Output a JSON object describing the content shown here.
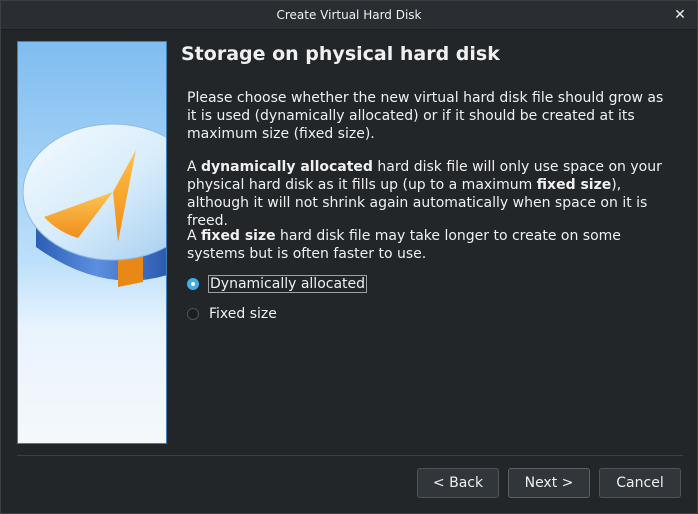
{
  "window": {
    "title": "Create Virtual Hard Disk"
  },
  "page": {
    "heading": "Storage on physical hard disk",
    "intro": "Please choose whether the new virtual hard disk file should grow as it is used (dynamically allocated) or if it should be created at its maximum size (fixed size).",
    "dynamic_desc": {
      "part1_bold": "dynamically allocated",
      "part0": "A ",
      "part2": " hard disk file will only use space on your physical hard disk as it fills up (up to a maximum ",
      "part3_bold": "fixed size",
      "part4": "), although it will not shrink again automatically when space on it is freed."
    },
    "fixed_desc": {
      "part0": "A ",
      "part1_bold": "fixed size",
      "part2": " hard disk file may take longer to create on some systems but is often faster to use."
    },
    "options": [
      {
        "label": "Dynamically allocated",
        "selected": true
      },
      {
        "label": "Fixed size",
        "selected": false
      }
    ]
  },
  "buttons": {
    "back": "< Back",
    "next": "Next >",
    "cancel": "Cancel"
  },
  "icons": {
    "close": "close-icon",
    "illustration": "hard-disk-illustration"
  },
  "colors": {
    "accent": "#3daee9",
    "background": "#232629"
  }
}
